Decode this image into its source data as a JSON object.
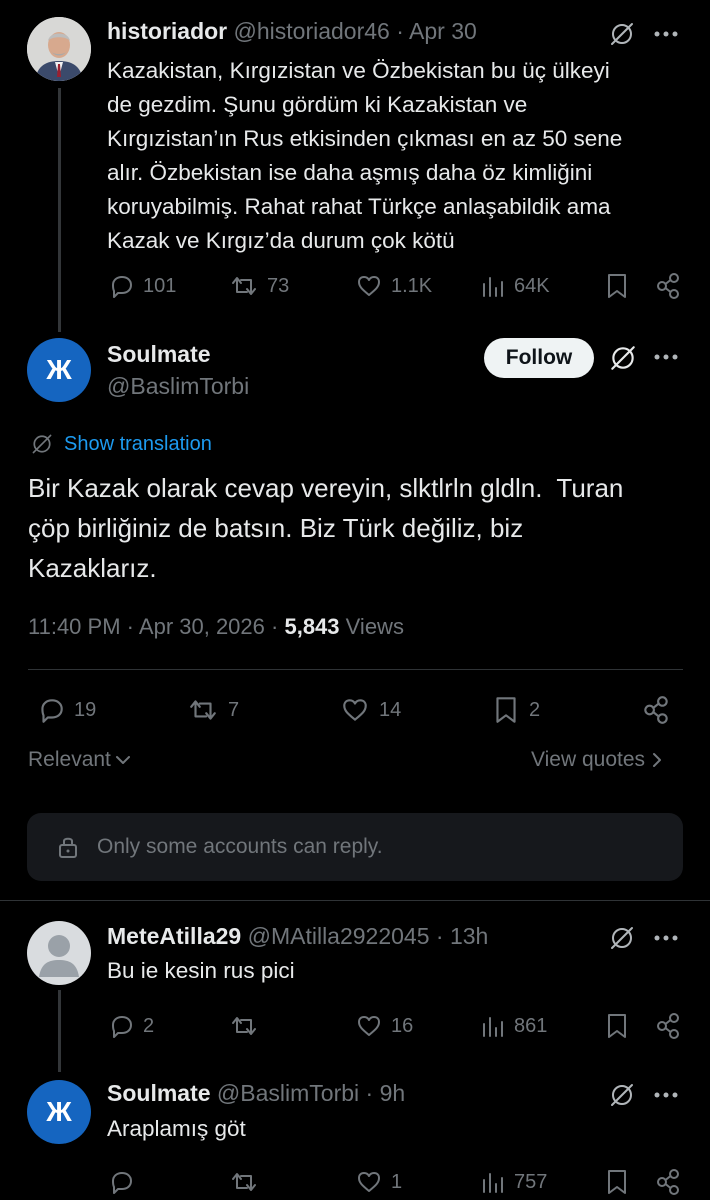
{
  "tweet1": {
    "name": "historiador",
    "handle": "@historiador46",
    "sep": "·",
    "date": "Apr 30",
    "lines": [
      "Kazakistan, Kırgızistan ve Özbekistan bu üç ülkeyi",
      "de gezdim. Şunu gördüm ki Kazakistan ve",
      "Kırgızistan’ın Rus etkisinden çıkması en az 50 sene",
      "alır. Özbekistan ise daha aşmış daha öz kimliğini",
      "koruyabilmiş. Rahat rahat Türkçe anlaşabildik ama",
      "Kazak ve Kırgız’da durum çok kötü"
    ],
    "replies": "101",
    "reposts": "73",
    "likes": "1.1K",
    "views": "64K"
  },
  "main": {
    "avatar_letter": "Ж",
    "name": "Soulmate",
    "handle": "@BaslimTorbi",
    "follow_label": "Follow",
    "show_translation": "Show translation",
    "lines": [
      "Bir Kazak olarak cevap vereyin, slktlrln gldln.  Turan",
      "çöp birliğiniz de batsın. Biz Türk değiliz, biz",
      "Kazaklarız."
    ],
    "time": "11:40 PM",
    "date": "Apr 30, 2026",
    "sep": "·",
    "views_count": "5,843",
    "views_label": "Views",
    "replies": "19",
    "reposts": "7",
    "likes": "14",
    "bookmarks": "2",
    "sort_label": "Relevant",
    "view_quotes": "View quotes",
    "reply_restriction": "Only some accounts can reply."
  },
  "reply1": {
    "name": "MeteAtilla29",
    "handle": "@MAtilla2922045",
    "sep": "·",
    "time": "13h",
    "text": "Bu ie kesin rus pici",
    "replies": "2",
    "likes": "16",
    "views": "861"
  },
  "reply2": {
    "avatar_letter": "Ж",
    "name": "Soulmate",
    "handle": "@BaslimTorbi",
    "sep": "·",
    "time": "9h",
    "text": "Araplamış göt",
    "likes": "1",
    "views": "757"
  },
  "colors": {
    "background": "#000000",
    "text": "#e7e9ea",
    "muted": "#71767b",
    "link": "#1d9bf0",
    "avatar": "#1565c0"
  }
}
